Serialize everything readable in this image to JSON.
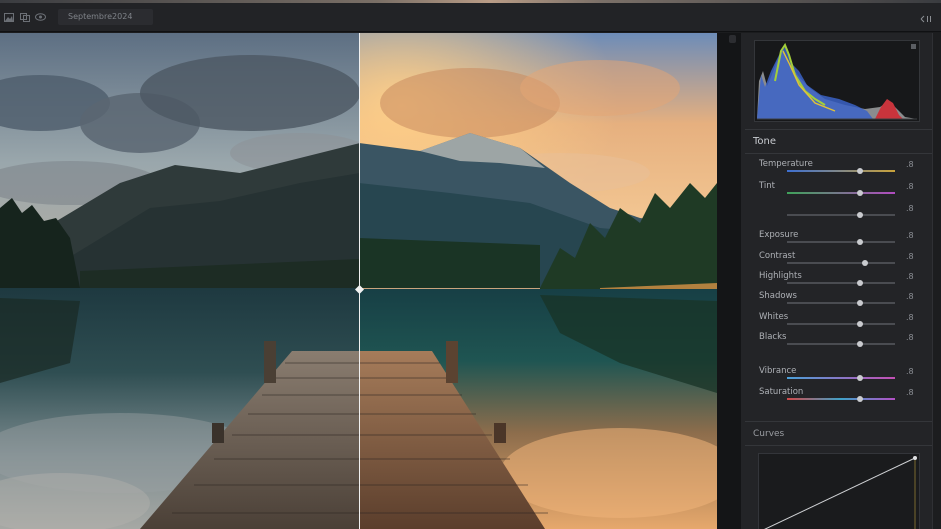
{
  "toolbar": {
    "title": "Septembre2024",
    "icons": [
      "image-icon",
      "layers-icon",
      "eye-icon"
    ]
  },
  "canvas": {
    "split_view": "before-after",
    "divider_position": 0.5
  },
  "panel": {
    "tone_section": "Tone",
    "curves_section": "Curves",
    "sliders": [
      {
        "key": "temperature",
        "label": "Temperature",
        "value": ".8",
        "level": 0.68,
        "track": "linear-gradient(90deg,#3d6fd1,#c9a23a)"
      },
      {
        "key": "tint",
        "label": "Tint",
        "value": ".8",
        "level": 0.68,
        "track": "linear-gradient(90deg,#3fa25a,#b14bc0)"
      },
      {
        "key": "unlabeled",
        "label": "",
        "value": ".8",
        "level": 0.68,
        "track": "#4a4c51"
      },
      {
        "key": "exposure",
        "label": "Exposure",
        "value": ".8",
        "level": 0.68,
        "track": "#4a4c51"
      },
      {
        "key": "contrast",
        "label": "Contrast",
        "value": ".8",
        "level": 0.72,
        "track": "#4a4c51"
      },
      {
        "key": "highlights",
        "label": "Highlights",
        "value": ".8",
        "level": 0.68,
        "track": "#4a4c51"
      },
      {
        "key": "shadows",
        "label": "Shadows",
        "value": ".8",
        "level": 0.68,
        "track": "#4a4c51"
      },
      {
        "key": "whites",
        "label": "Whites",
        "value": ".8",
        "level": 0.68,
        "track": "#4a4c51"
      },
      {
        "key": "blacks",
        "label": "Blacks",
        "value": ".8",
        "level": 0.68,
        "track": "#4a4c51"
      },
      {
        "key": "vibrance",
        "label": "Vibrance",
        "value": ".8",
        "level": 0.68,
        "track": "linear-gradient(90deg,#4aa0d8,#c44fb4)"
      },
      {
        "key": "saturation",
        "label": "Saturation",
        "value": ".8",
        "level": 0.68,
        "track": "linear-gradient(90deg,#d14a4a,#3fa2c9,#b44fc6)"
      }
    ]
  },
  "colors": {
    "accent": "#c9cbcf",
    "panel_bg": "#232427",
    "hist_red": "#c8343c",
    "hist_green": "#9acb3a",
    "hist_blue": "#2f62c9",
    "hist_yellow": "#e0c23a"
  }
}
